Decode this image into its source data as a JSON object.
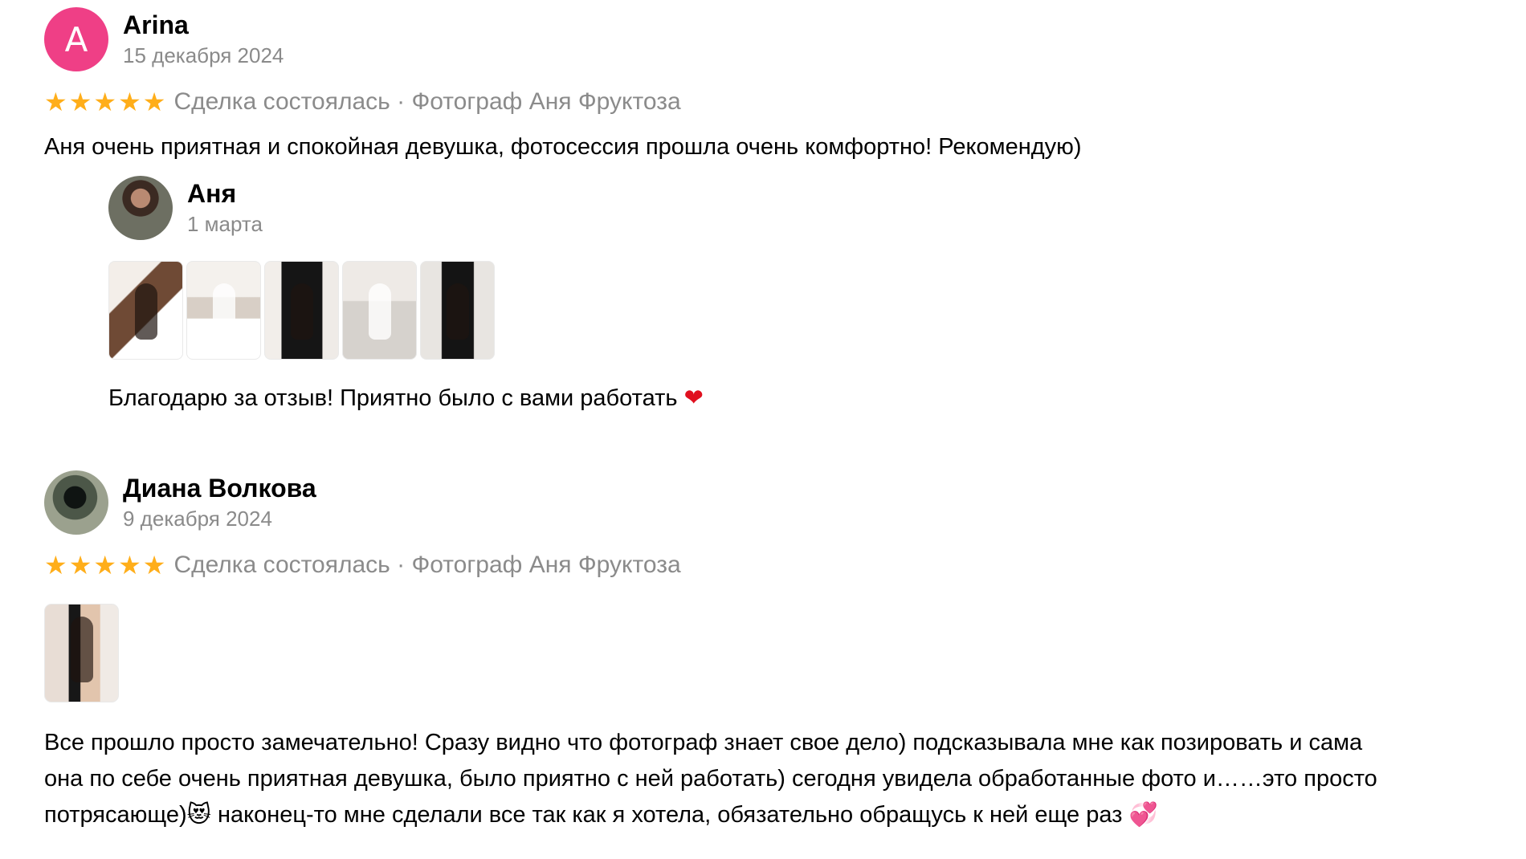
{
  "reviews": [
    {
      "author": "Arina",
      "date": "15 декабря 2024",
      "avatar_letter": "A",
      "rating": 5,
      "deal_text": "Сделка состоялась · Фотограф Аня Фруктоза",
      "text": "Аня очень приятная и спокойная девушка, фотосессия прошла очень комфортно! Рекомендую)",
      "reply": {
        "author": "Аня",
        "date": "1 марта",
        "text": "Благодарю за отзыв! Приятно было с вами работать",
        "emoji": "❤"
      }
    },
    {
      "author": "Диана Волкова",
      "date": "9 декабря 2024",
      "rating": 5,
      "deal_text": "Сделка состоялась · Фотограф Аня Фруктоза",
      "text": "Все прошло просто замечательно! Сразу видно что фотограф знает свое дело) подсказывала мне как позировать и сама\nона по себе очень приятная девушка, было приятно с ней работать) сегодня увидела обработанные фото и……это просто\nпотрясающе)😻 наконец-то мне сделали все так как я хотела, обязательно обращусь к ней еще раз 💞"
    }
  ],
  "colors": {
    "star": "#ffae1a",
    "avatar_letter_bg": "#ef3f86",
    "muted_text": "#8a8a8a"
  }
}
